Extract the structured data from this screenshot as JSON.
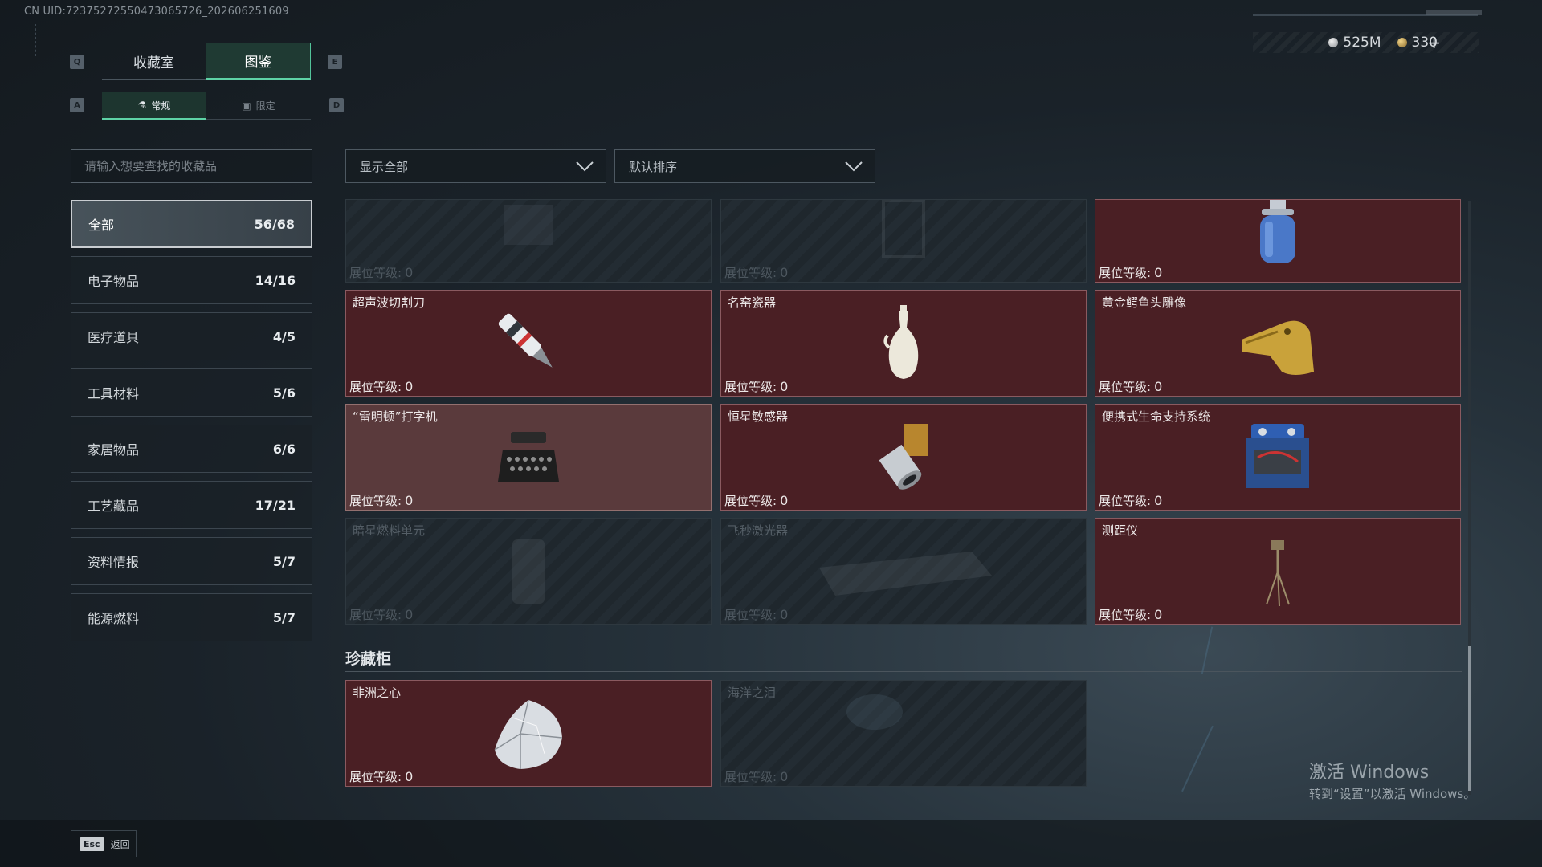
{
  "uid": "CN UID:72375272550473065726_202606251609",
  "currency": {
    "silver": "525M",
    "gold": "330",
    "plus": "+"
  },
  "keys": {
    "q": "Q",
    "e": "E",
    "a": "A",
    "d": "D"
  },
  "main_tabs": [
    {
      "label": "收藏室",
      "active": false
    },
    {
      "label": "图鉴",
      "active": true
    }
  ],
  "sub_tabs": [
    {
      "label": "常规",
      "icon": "flask-icon",
      "active": true
    },
    {
      "label": "限定",
      "icon": "image-icon",
      "active": false
    }
  ],
  "search": {
    "placeholder": "请输入想要查找的收藏品",
    "value": ""
  },
  "filters": {
    "show": "显示全部",
    "sort": "默认排序"
  },
  "categories": [
    {
      "label": "全部",
      "count": "56/68",
      "active": true
    },
    {
      "label": "电子物品",
      "count": "14/16"
    },
    {
      "label": "医疗道具",
      "count": "4/5"
    },
    {
      "label": "工具材料",
      "count": "5/6"
    },
    {
      "label": "家居物品",
      "count": "6/6"
    },
    {
      "label": "工艺藏品",
      "count": "17/21"
    },
    {
      "label": "资料情报",
      "count": "5/7"
    },
    {
      "label": "能源燃料",
      "count": "5/7"
    }
  ],
  "level_label": "展位等级:",
  "items": [
    {
      "name": "",
      "level": "0",
      "owned": false,
      "art": "device-icon"
    },
    {
      "name": "",
      "level": "0",
      "owned": false,
      "art": "cabinet-icon"
    },
    {
      "name": "",
      "level": "0",
      "owned": true,
      "art": "gas-canister-icon"
    },
    {
      "name": "超声波切割刀",
      "level": "0",
      "owned": true,
      "art": "cutter-icon"
    },
    {
      "name": "名窑瓷器",
      "level": "0",
      "owned": true,
      "art": "vase-icon"
    },
    {
      "name": "黄金鳄鱼头雕像",
      "level": "0",
      "owned": true,
      "art": "croc-statue-icon"
    },
    {
      "name": "“雷明顿”打字机",
      "level": "0",
      "owned": true,
      "art": "typewriter-icon"
    },
    {
      "name": "恒星敏感器",
      "level": "0",
      "owned": true,
      "art": "star-sensor-icon"
    },
    {
      "name": "便携式生命支持系统",
      "level": "0",
      "owned": true,
      "art": "life-support-icon"
    },
    {
      "name": "暗星燃料单元",
      "level": "0",
      "owned": false,
      "art": "fuel-cell-icon"
    },
    {
      "name": "飞秒激光器",
      "level": "0",
      "owned": false,
      "art": "laser-icon"
    },
    {
      "name": "测距仪",
      "level": "0",
      "owned": true,
      "art": "tripod-icon"
    }
  ],
  "cabinet": {
    "title": "珍藏柜",
    "items": [
      {
        "name": "非洲之心",
        "level": "0",
        "owned": true,
        "art": "diamond-icon"
      },
      {
        "name": "海洋之泪",
        "level": "0",
        "owned": false,
        "art": "gem-icon"
      }
    ]
  },
  "watermark": {
    "line1": "激活 Windows",
    "line2": "转到“设置”以激活 Windows。"
  },
  "footer": {
    "esc_key": "Esc",
    "esc_label": "返回"
  },
  "colors": {
    "accent": "#5ed3a6",
    "owned_card": "#4a1f24",
    "highlight_card": "#5a3a3c",
    "locked_card": "#1f272d"
  }
}
